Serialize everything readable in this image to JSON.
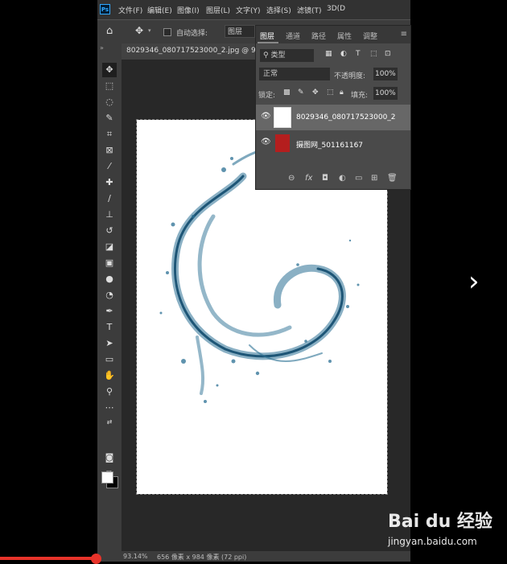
{
  "menubar": {
    "logo": "Ps",
    "items": [
      "文件(F)",
      "编辑(E)",
      "图像(I)",
      "图层(L)",
      "文字(Y)",
      "选择(S)",
      "滤镜(T)",
      "3D(D"
    ]
  },
  "options_bar": {
    "home_icon": "home-icon",
    "auto_select_label": "自动选择:",
    "auto_select_value": "图层"
  },
  "document": {
    "tab_title": "8029346_080717523000_2.jpg @ 93"
  },
  "status_bar": {
    "zoom": "93.14%",
    "doc_size": "656 像素 x 984 像素 (72 ppi)"
  },
  "layers_panel": {
    "tabs": [
      "图层",
      "通道",
      "路径",
      "属性",
      "调整"
    ],
    "filter_kind": "类型",
    "blend_mode": "正常",
    "opacity_label": "不透明度:",
    "opacity_value": "100%",
    "lock_label": "锁定:",
    "fill_label": "填充:",
    "fill_value": "100%",
    "layers": [
      {
        "name": "8029346_080717523000_2",
        "selected": true
      },
      {
        "name": "摄图网_501161167",
        "selected": false
      }
    ]
  },
  "watermark": {
    "brand": "Bai du 经验",
    "url": "jingyan.baidu.com"
  },
  "video_progress": 0.19,
  "colors": {
    "ps_bg": "#535353",
    "panel": "#4a4a4a",
    "accent_red": "#e8332a",
    "water_blue": "#2a6f93"
  }
}
